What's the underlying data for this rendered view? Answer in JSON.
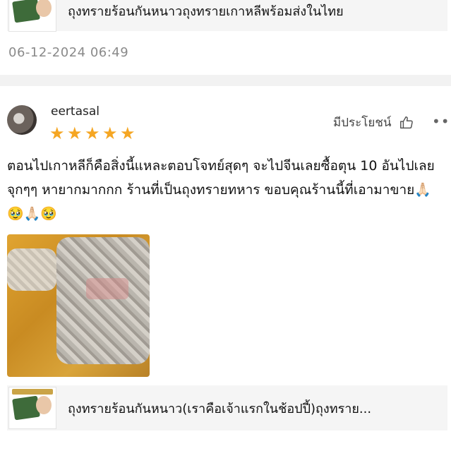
{
  "top_product": {
    "title": "ถุงทรายร้อนกันหนาวถุงทรายเกาหลีพร้อมส่งในไทย"
  },
  "top_review": {
    "timestamp": "06-12-2024 06:49"
  },
  "review": {
    "username": "eertasal",
    "rating": 5,
    "stars": [
      "★",
      "★",
      "★",
      "★",
      "★"
    ],
    "helpful_label": "มีประโยชน์",
    "more_label": "•••",
    "text": "ตอนไปเกาหลีก็คือสิ่งนี้แหละตอบโจทย์สุดๆ จะไปจีนเลยซื้อตุน 10 อันไปเลยจุกๆๆ หายากมากกก ร้านที่เป็นถุงทรายทหาร ขอบคุณร้านนี้ที่เอามาขาย🙏🏻🥹🙏🏻🥹",
    "product_title": "ถุงทรายร้อนกันหนาว(เราคือเจ้าแรกในช้อปปี้)ถุงทราย..."
  },
  "colors": {
    "star": "#f5a623",
    "background": "#f2f2f2",
    "card": "#ffffff",
    "timestamp": "#8a8a8a"
  },
  "icons": {
    "helpful": "thumbs-up-icon",
    "more": "more-dots-icon"
  }
}
